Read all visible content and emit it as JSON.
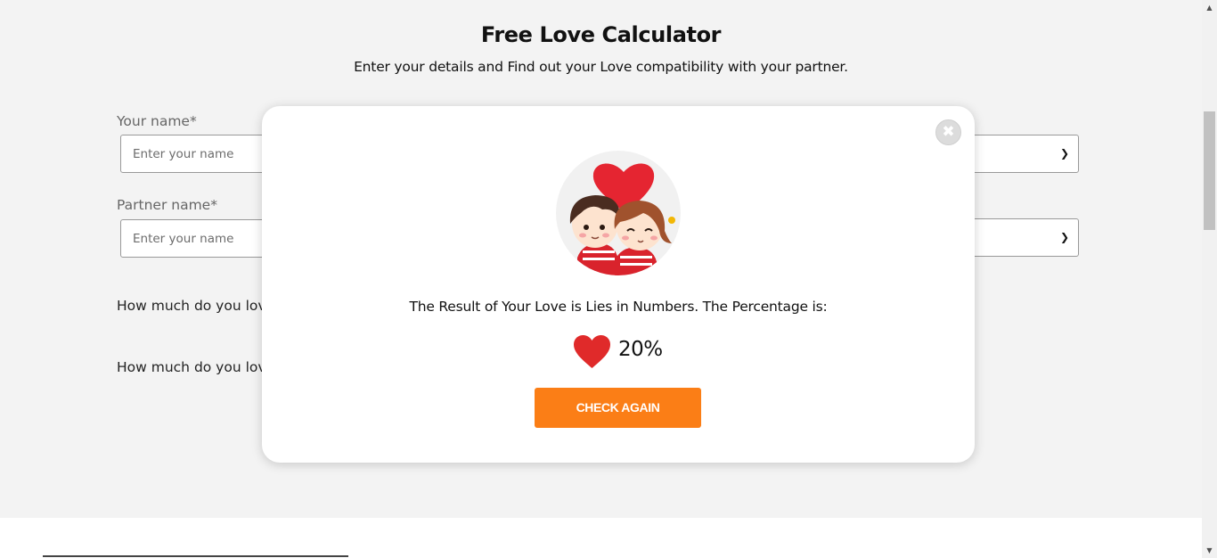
{
  "header": {
    "title": "Free Love Calculator",
    "subtitle": "Enter your details and Find out your Love compatibility with your partner."
  },
  "form": {
    "your_name_label": "Your name*",
    "your_name_placeholder": "Enter your name",
    "your_name_value": "",
    "partner_name_label": "Partner name*",
    "partner_name_placeholder": "Enter your name",
    "partner_name_value": "",
    "question_1": "How much do you love",
    "question_2": "How much do you love"
  },
  "modal": {
    "result_text": "The Result of Your Love is Lies in Numbers. The Percentage is:",
    "percentage": "20%",
    "check_again_label": "CHECK AGAIN",
    "close_icon": "close-icon",
    "heart_icon": "heart-icon",
    "illustration": "couple-with-heart"
  },
  "colors": {
    "accent": "#fb7e16",
    "heart": "#e02a2a",
    "page_bg": "#f3f3f3",
    "modal_bg": "#ffffff"
  }
}
